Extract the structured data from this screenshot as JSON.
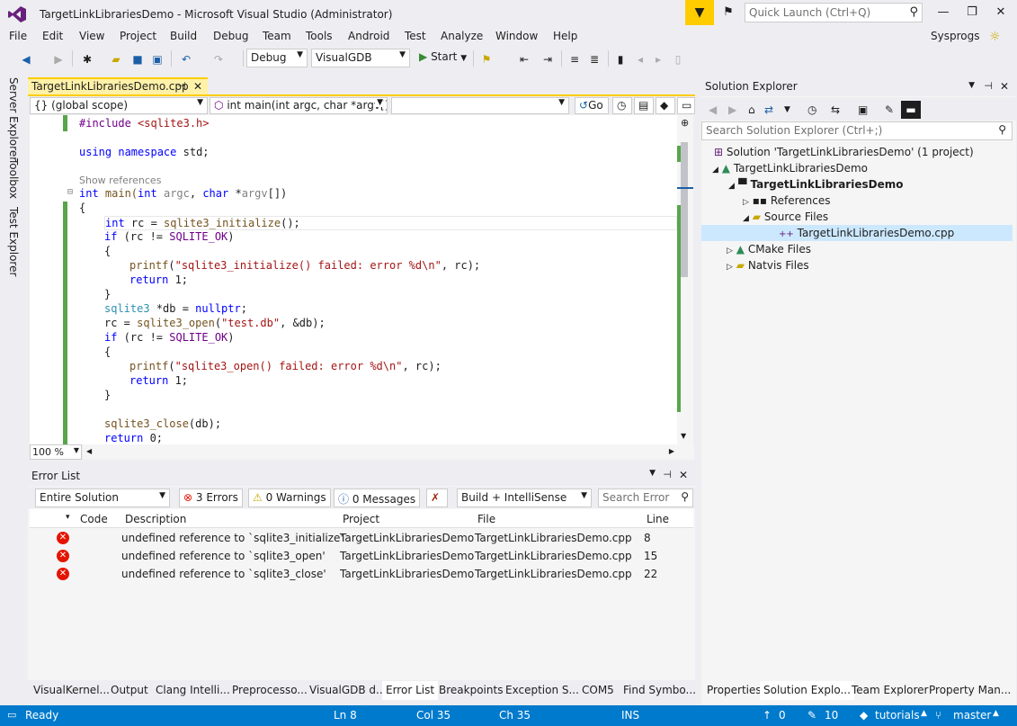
{
  "window": {
    "title": "TargetLinkLibrariesDemo - Microsoft Visual Studio  (Administrator)",
    "quick_launch_placeholder": "Quick Launch (Ctrl+Q)",
    "user": "Sysprogs"
  },
  "menu": [
    "File",
    "Edit",
    "View",
    "Project",
    "Build",
    "Debug",
    "Team",
    "Tools",
    "Android",
    "Test",
    "Analyze",
    "Window",
    "Help"
  ],
  "toolbar": {
    "config": "Debug",
    "platform": "VisualGDB",
    "start_label": "Start"
  },
  "left_tabs": [
    "Server Explorer",
    "Toolbox",
    "Test Explorer"
  ],
  "editor": {
    "tab_label": "TargetLinkLibrariesDemo.cpp",
    "scope": "{} (global scope)",
    "function": "int main(int argc, char *argv[])",
    "member": "",
    "go_label": "Go",
    "zoom": "100 %",
    "show_references": "Show references",
    "lines": {
      "l1a": "#include ",
      "l1b": "<sqlite3.h>",
      "l2a": "using",
      "l2b": " ",
      "l2c": "namespace",
      "l2d": " std;",
      "l3a": "int",
      "l3b": " main(",
      "l3c": "int",
      "l3d": " ",
      "l3e": "argc",
      "l3f": ", ",
      "l3g": "char",
      "l3h": " *",
      "l3i": "argv",
      "l3j": "[])",
      "l4": "{",
      "l5a": "int",
      "l5b": " rc = ",
      "l5c": "sqlite3_initialize",
      "l5d": "();",
      "l6a": "if",
      "l6b": " (rc != ",
      "l6c": "SQLITE_OK",
      "l6d": ")",
      "l7": "{",
      "l8a": "printf",
      "l8b": "(",
      "l8c": "\"sqlite3_initialize() failed: error %d\\n\"",
      "l8d": ", rc);",
      "l9a": "return",
      "l9b": " 1;",
      "l10": "}",
      "l11a": "sqlite3",
      "l11b": " *db = ",
      "l11c": "nullptr",
      "l11d": ";",
      "l12a": "rc = ",
      "l12b": "sqlite3_open",
      "l12c": "(",
      "l12d": "\"test.db\"",
      "l12e": ", &db);",
      "l13a": "if",
      "l13b": " (rc != ",
      "l13c": "SQLITE_OK",
      "l13d": ")",
      "l14": "{",
      "l15a": "printf",
      "l15b": "(",
      "l15c": "\"sqlite3_open() failed: error %d\\n\"",
      "l15d": ", rc);",
      "l16a": "return",
      "l16b": " 1;",
      "l17": "}",
      "l18a": "sqlite3_close",
      "l18b": "(db);",
      "l19a": "return",
      "l19b": " 0;"
    }
  },
  "solution_explorer": {
    "title": "Solution Explorer",
    "search_placeholder": "Search Solution Explorer (Ctrl+;)",
    "solution": "Solution 'TargetLinkLibrariesDemo' (1 project)",
    "cmake_root": "TargetLinkLibrariesDemo",
    "project": "TargetLinkLibrariesDemo",
    "references": "References",
    "source_files": "Source Files",
    "cpp_file": "TargetLinkLibrariesDemo.cpp",
    "cmake_files": "CMake Files",
    "natvis_files": "Natvis Files"
  },
  "error_list": {
    "title": "Error List",
    "scope": "Entire Solution",
    "errors": "3 Errors",
    "warnings": "0 Warnings",
    "messages": "0 Messages",
    "source": "Build + IntelliSense",
    "search_placeholder": "Search Error",
    "columns": {
      "code": "Code",
      "description": "Description",
      "project": "Project",
      "file": "File",
      "line": "Line"
    },
    "rows": [
      {
        "description": "undefined reference to `sqlite3_initialize'",
        "project": "TargetLinkLibrariesDemo",
        "file": "TargetLinkLibrariesDemo.cpp",
        "line": "8"
      },
      {
        "description": "undefined reference to `sqlite3_open'",
        "project": "TargetLinkLibrariesDemo",
        "file": "TargetLinkLibrariesDemo.cpp",
        "line": "15"
      },
      {
        "description": "undefined reference to `sqlite3_close'",
        "project": "TargetLinkLibrariesDemo",
        "file": "TargetLinkLibrariesDemo.cpp",
        "line": "22"
      }
    ]
  },
  "bottom_tabs": [
    "VisualKernel...",
    "Output",
    "Clang Intelli...",
    "Preprocesso...",
    "VisualGDB d...",
    "Error List",
    "Breakpoints",
    "Exception S...",
    "COM5",
    "Find Symbo..."
  ],
  "se_tabs": [
    "Properties",
    "Solution Explo...",
    "Team Explorer",
    "Property Man..."
  ],
  "status": {
    "ready": "Ready",
    "line": "Ln 8",
    "col": "Col 35",
    "ch": "Ch 35",
    "mode": "INS",
    "up": "0",
    "edits": "10",
    "repo": "tutorials",
    "branch": "master"
  },
  "colors": {
    "accent": "#007acc",
    "tab_active": "#fff1a8",
    "error": "#e51400",
    "notification": "#ffcc00"
  }
}
